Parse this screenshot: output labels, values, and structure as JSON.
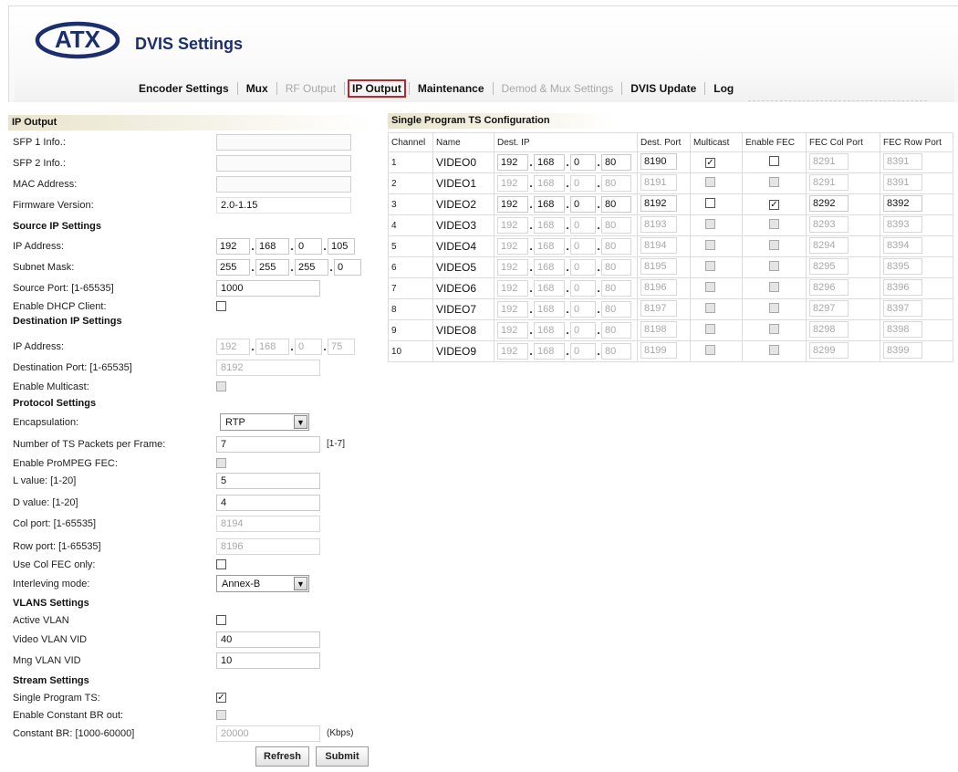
{
  "header": {
    "brand": "ATX",
    "app_title": "DVIS Settings"
  },
  "nav": {
    "items": [
      {
        "label": "Encoder Settings",
        "state": "bold"
      },
      {
        "label": "Mux",
        "state": "bold"
      },
      {
        "label": "RF Output",
        "state": "dim"
      },
      {
        "label": "IP Output",
        "state": "active"
      },
      {
        "label": "Maintenance",
        "state": "bold"
      },
      {
        "label": "Demod & Mux Settings",
        "state": "dim"
      },
      {
        "label": "DVIS Update",
        "state": "bold"
      },
      {
        "label": "Log",
        "state": "bold"
      }
    ]
  },
  "left": {
    "header": "IP Output",
    "sfp1_label": "SFP 1 Info.:",
    "sfp2_label": "SFP 2 Info.:",
    "mac_label": "MAC Address:",
    "fw_label": "Firmware Version:",
    "fw_value": "2.0-1.15",
    "source_heading": "Source IP Settings",
    "src_ip_label": "IP Address:",
    "src_ip": [
      "192",
      "168",
      "0",
      "105"
    ],
    "subnet_label": "Subnet Mask:",
    "subnet": [
      "255",
      "255",
      "255",
      "0"
    ],
    "src_port_label": "Source Port: [1-65535]",
    "src_port": "1000",
    "dhcp_label": "Enable DHCP Client:",
    "dest_heading": "Destination IP Settings",
    "dst_ip_label": "IP Address:",
    "dst_ip": [
      "192",
      "168",
      "0",
      "75"
    ],
    "dst_port_label": "Destination Port: [1-65535]",
    "dst_port": "8192",
    "multicast_label": "Enable Multicast:",
    "protocol_heading": "Protocol Settings",
    "encap_label": "Encapsulation:",
    "encap_value": "RTP",
    "ts_label": "Number of TS Packets per Frame:",
    "ts_value": "7",
    "ts_range": "[1-7]",
    "fec_label": "Enable ProMPEG FEC:",
    "l_label": "L value: [1-20]",
    "l_value": "5",
    "d_label": "D value: [1-20]",
    "d_value": "4",
    "col_label": "Col port: [1-65535]",
    "col_value": "8194",
    "row_label": "Row port: [1-65535]",
    "row_value": "8196",
    "colonly_label": "Use Col FEC only:",
    "interleave_label": "Interleving mode:",
    "interleave_value": "Annex-B",
    "vlan_heading": "VLANS Settings",
    "active_vlan_label": "Active VLAN",
    "video_vlan_label": "Video VLAN VID",
    "video_vlan": "40",
    "mng_vlan_label": "Mng VLAN VID",
    "mng_vlan": "10",
    "stream_heading": "Stream Settings",
    "spts_label": "Single Program TS:",
    "cbr_enable_label": "Enable Constant BR out:",
    "cbr_label": "Constant BR: [1000-60000]",
    "cbr_value": "20000",
    "cbr_unit": "(Kbps)",
    "refresh": "Refresh",
    "submit": "Submit"
  },
  "spts": {
    "header": "Single Program TS Configuration",
    "columns": [
      "Channel",
      "Name",
      "Dest. IP",
      "Dest. Port",
      "Multicast",
      "Enable FEC",
      "FEC Col Port",
      "FEC Row Port"
    ],
    "rows": [
      {
        "channel": "1",
        "name": "VIDEO0",
        "ip": [
          "192",
          "168",
          "0",
          "80"
        ],
        "port": "8190",
        "multicast": true,
        "fec": false,
        "col": "8291",
        "row": "8391",
        "enabled": true,
        "fec_enabled": false
      },
      {
        "channel": "2",
        "name": "VIDEO1",
        "ip": [
          "192",
          "168",
          "0",
          "80"
        ],
        "port": "8191",
        "multicast": false,
        "fec": false,
        "col": "8291",
        "row": "8391",
        "enabled": false,
        "fec_enabled": false
      },
      {
        "channel": "3",
        "name": "VIDEO2",
        "ip": [
          "192",
          "168",
          "0",
          "80"
        ],
        "port": "8192",
        "multicast": false,
        "fec": true,
        "col": "8292",
        "row": "8392",
        "enabled": true,
        "fec_enabled": true
      },
      {
        "channel": "4",
        "name": "VIDEO3",
        "ip": [
          "192",
          "168",
          "0",
          "80"
        ],
        "port": "8193",
        "multicast": false,
        "fec": false,
        "col": "8293",
        "row": "8393",
        "enabled": false,
        "fec_enabled": false
      },
      {
        "channel": "5",
        "name": "VIDEO4",
        "ip": [
          "192",
          "168",
          "0",
          "80"
        ],
        "port": "8194",
        "multicast": false,
        "fec": false,
        "col": "8294",
        "row": "8394",
        "enabled": false,
        "fec_enabled": false
      },
      {
        "channel": "6",
        "name": "VIDEO5",
        "ip": [
          "192",
          "168",
          "0",
          "80"
        ],
        "port": "8195",
        "multicast": false,
        "fec": false,
        "col": "8295",
        "row": "8395",
        "enabled": false,
        "fec_enabled": false
      },
      {
        "channel": "7",
        "name": "VIDEO6",
        "ip": [
          "192",
          "168",
          "0",
          "80"
        ],
        "port": "8196",
        "multicast": false,
        "fec": false,
        "col": "8296",
        "row": "8396",
        "enabled": false,
        "fec_enabled": false
      },
      {
        "channel": "8",
        "name": "VIDEO7",
        "ip": [
          "192",
          "168",
          "0",
          "80"
        ],
        "port": "8197",
        "multicast": false,
        "fec": false,
        "col": "8297",
        "row": "8397",
        "enabled": false,
        "fec_enabled": false
      },
      {
        "channel": "9",
        "name": "VIDEO8",
        "ip": [
          "192",
          "168",
          "0",
          "80"
        ],
        "port": "8198",
        "multicast": false,
        "fec": false,
        "col": "8298",
        "row": "8398",
        "enabled": false,
        "fec_enabled": false
      },
      {
        "channel": "10",
        "name": "VIDEO9",
        "ip": [
          "192",
          "168",
          "0",
          "80"
        ],
        "port": "8199",
        "multicast": false,
        "fec": false,
        "col": "8299",
        "row": "8399",
        "enabled": false,
        "fec_enabled": false
      }
    ]
  },
  "colors": {
    "brand": "#1b2e6e",
    "active_tab_border": "#c0242b",
    "section_header_from": "#e9e4cc",
    "section_header_to": "#ffffff"
  }
}
